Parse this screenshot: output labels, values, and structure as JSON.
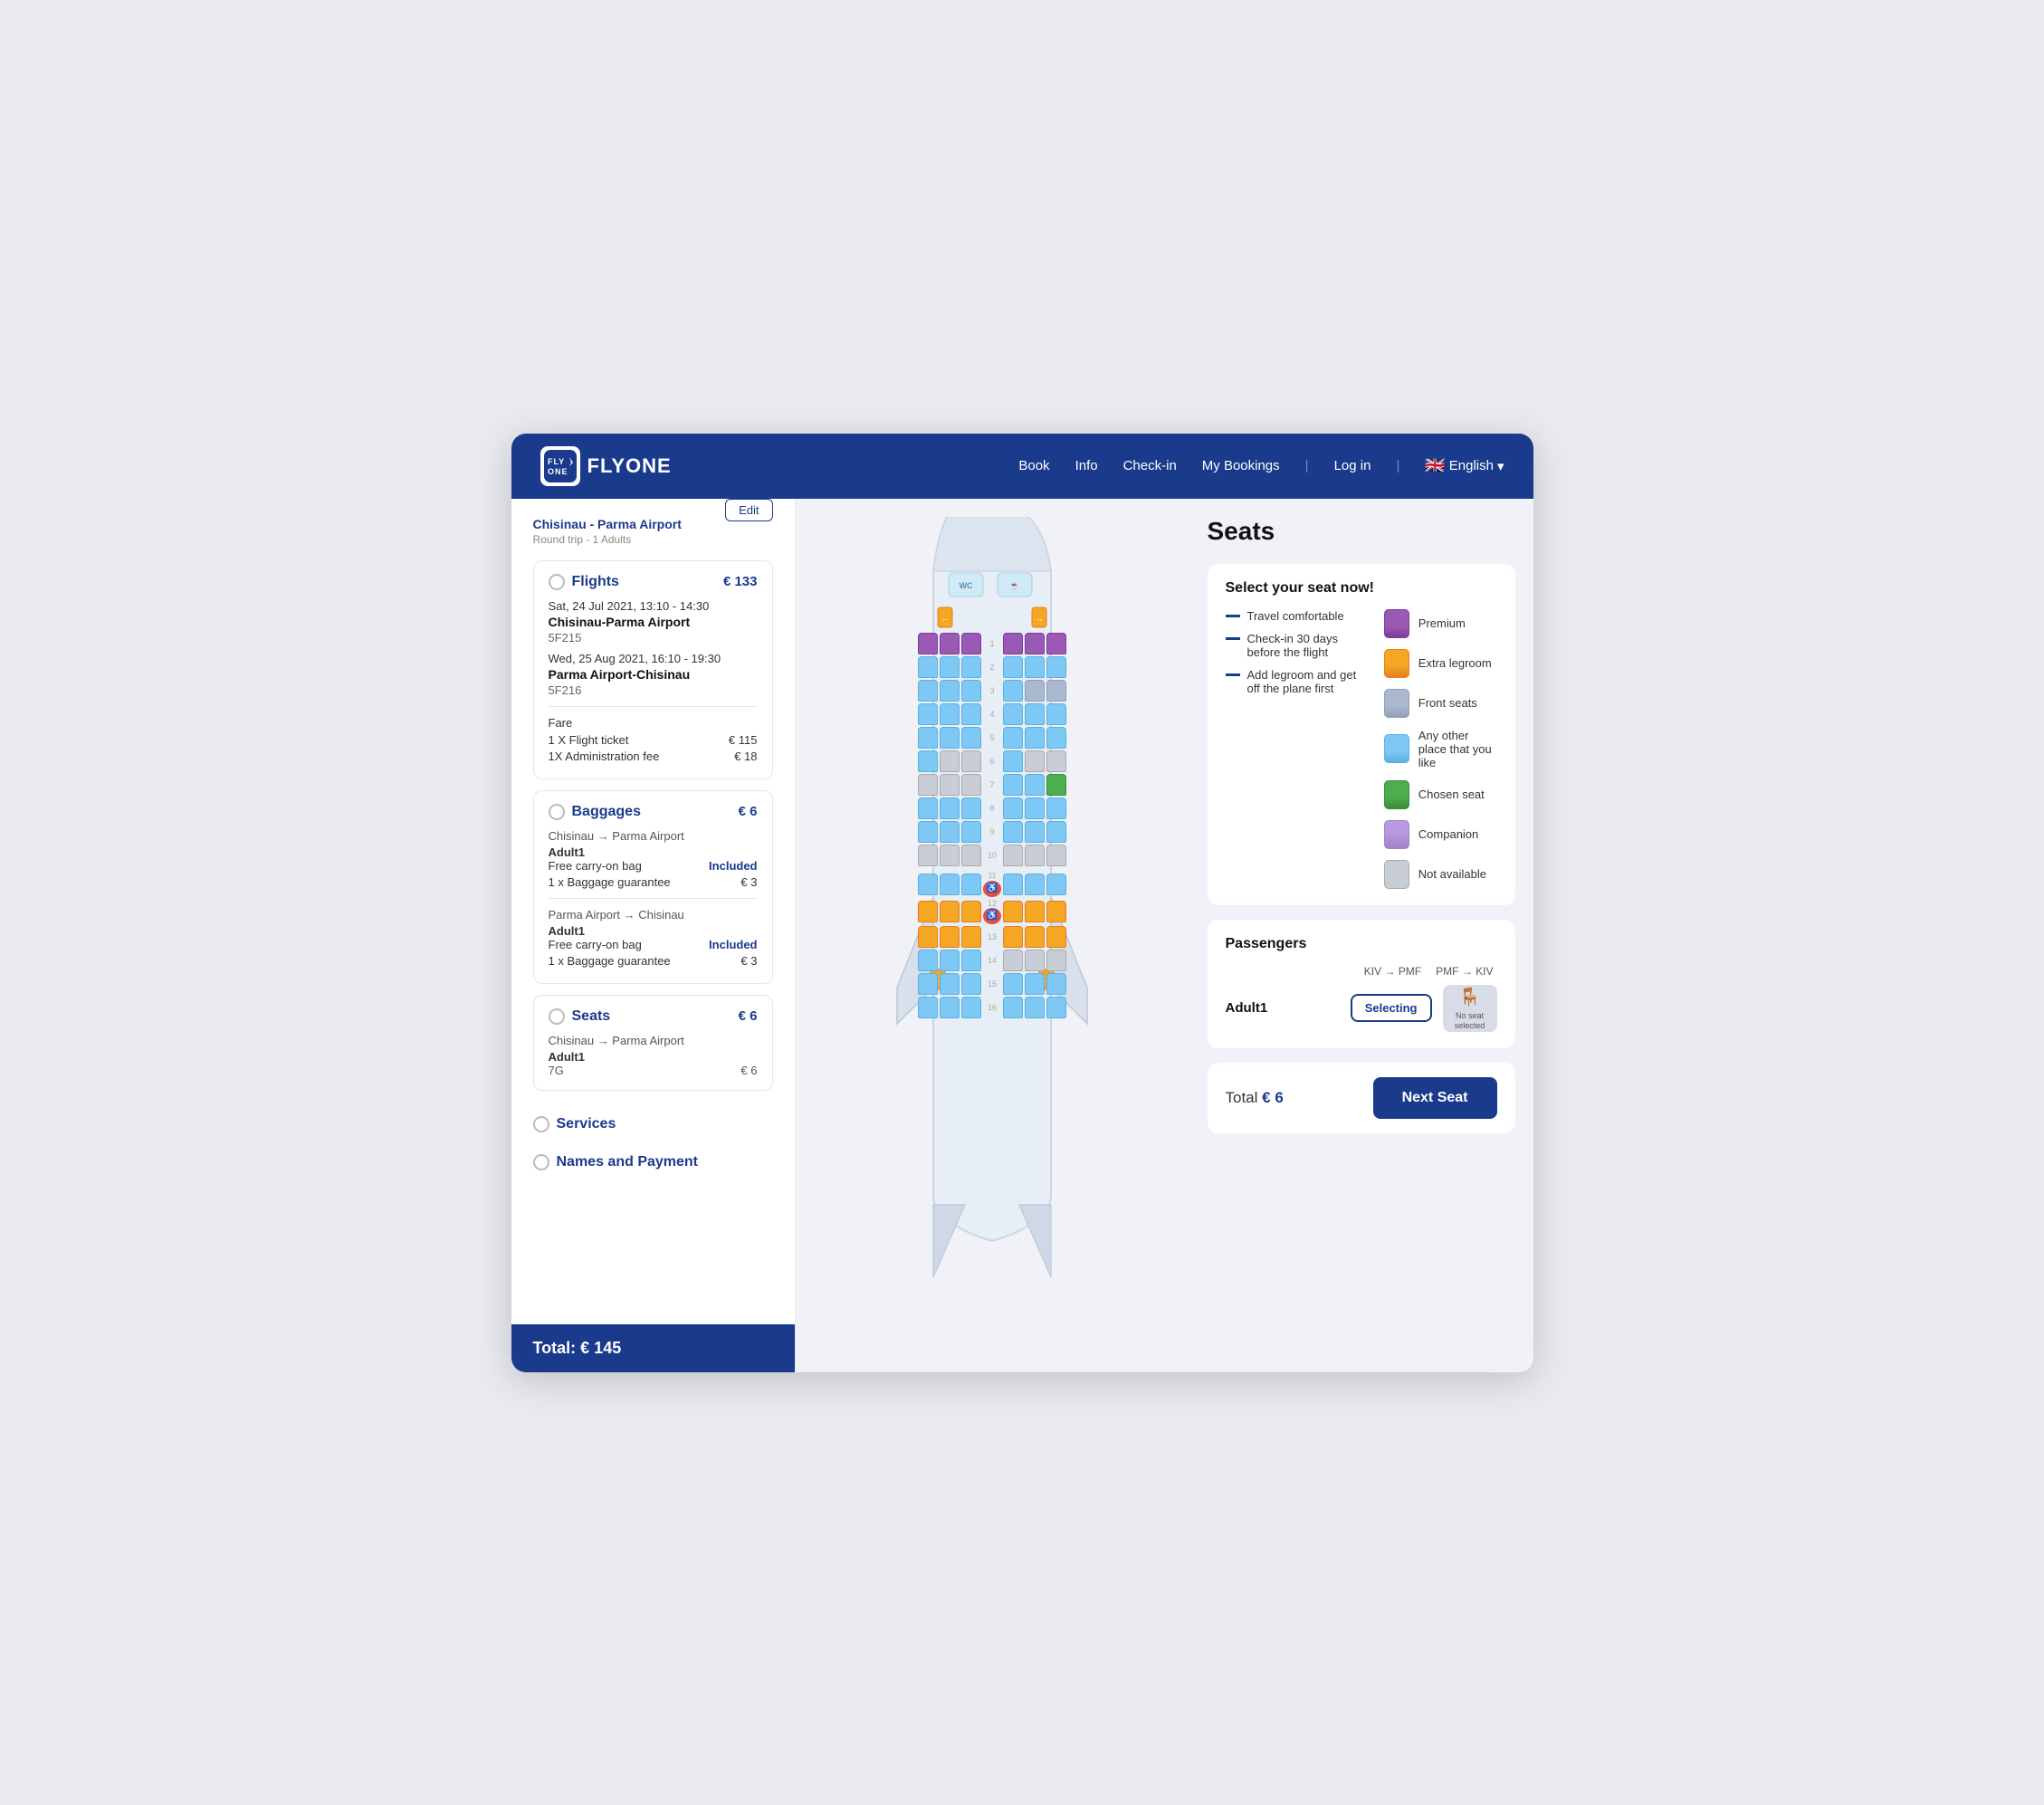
{
  "app": {
    "logo": "FLYONE",
    "title": "FLYONE"
  },
  "nav": {
    "book": "Book",
    "info": "Info",
    "checkin": "Check-in",
    "mybookings": "My Bookings",
    "login": "Log in",
    "language": "English"
  },
  "sidebar": {
    "route": "Chisinau - Parma Airport",
    "triptype": "Round trip - 1 Adults",
    "edit_label": "Edit",
    "flights_label": "Flights",
    "flights_price": "€ 133",
    "flight1_date": "Sat, 24 Jul 2021, 13:10 - 14:30",
    "flight1_route": "Chisinau-Parma Airport",
    "flight1_num": "5F215",
    "flight2_date": "Wed, 25 Aug 2021, 16:10 - 19:30",
    "flight2_route": "Parma Airport-Chisinau",
    "flight2_num": "5F216",
    "fare_label": "Fare",
    "ticket_label": "1 X  Flight ticket",
    "ticket_price": "€ 115",
    "admin_label": "1X  Administration fee",
    "admin_price": "€ 18",
    "baggages_label": "Baggages",
    "baggages_price": "€ 6",
    "bag1_route": "Chisinau → Parma Airport",
    "bag1_passenger": "Adult1",
    "bag1_carry": "Free carry-on bag",
    "bag1_carry_val": "Included",
    "bag1_guarantee": "1 x  Baggage guarantee",
    "bag1_guarantee_price": "€ 3",
    "bag2_route": "Parma Airport → Chisinau",
    "bag2_passenger": "Adult1",
    "bag2_carry": "Free carry-on bag",
    "bag2_carry_val": "Included",
    "bag2_guarantee": "1 x  Baggage guarantee",
    "bag2_guarantee_price": "€ 3",
    "seats_label": "Seats",
    "seats_price": "€ 6",
    "seats_route": "Chisinau → Parma Airport",
    "seats_passenger": "Adult1",
    "seats_seat": "7G",
    "seats_seat_price": "€ 6",
    "services_label": "Services",
    "names_label": "Names and Payment",
    "total_label": "Total:",
    "total_price": "€ 145"
  },
  "main": {
    "seats_heading": "Seats"
  },
  "legend": {
    "title": "Select your seat now!",
    "feature1": "Travel comfortable",
    "feature2": "Check-in 30 days before the flight",
    "feature3": "Add legroom and get off the plane first",
    "premium": "Premium",
    "extra_legroom": "Extra legroom",
    "front_seats": "Front seats",
    "any_other": "Any other place that you like",
    "chosen": "Chosen seat",
    "companion": "Companion",
    "not_available": "Not available"
  },
  "passengers": {
    "title": "Passengers",
    "route1_from": "KIV",
    "route1_arrow": "→",
    "route1_to": "PMF",
    "route2_from": "PMF",
    "route2_arrow": "→",
    "route2_to": "KIV",
    "passenger1_name": "Adult1",
    "selecting_label": "Selecting",
    "no_seat_label": "No seat selected"
  },
  "bottom": {
    "total_label": "Total",
    "total_price": "€ 6",
    "next_seat_label": "Next Seat"
  }
}
